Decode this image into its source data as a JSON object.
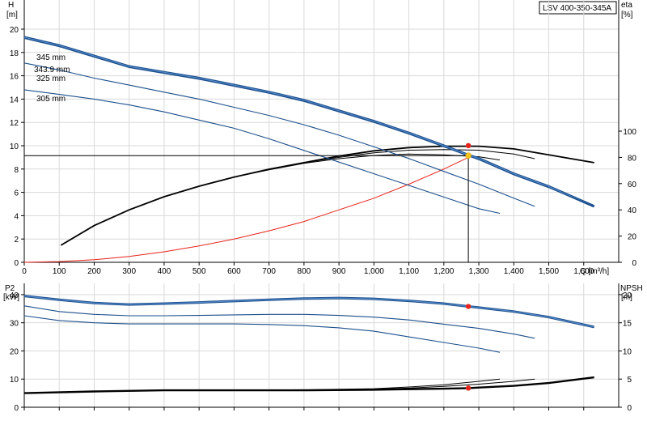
{
  "chart_data": [
    {
      "type": "line",
      "model_label": "LSV 400-350-345A",
      "axes": {
        "x": {
          "label": "Q [m³/h]",
          "ticks": [
            0,
            100,
            200,
            300,
            400,
            500,
            600,
            700,
            800,
            900,
            1000,
            1100,
            1200,
            1300,
            1400,
            1500,
            1600
          ],
          "tick_labels": [
            "0",
            "100",
            "200",
            "300",
            "400",
            "500",
            "600",
            "700",
            "800",
            "900",
            "1,000",
            "1,100",
            "1,200",
            "1,300",
            "1,400",
            "1,500",
            "1,600"
          ],
          "range": [
            0,
            1700
          ]
        },
        "y_left": {
          "label_line1": "H",
          "label_line2": "[m]",
          "ticks": [
            0,
            2,
            4,
            6,
            8,
            10,
            12,
            14,
            16,
            18,
            20
          ],
          "range": [
            0,
            22.5
          ]
        },
        "y_right": {
          "label_line1": "eta",
          "label_line2": "[%]",
          "ticks": [
            0,
            20,
            40,
            60,
            80,
            100
          ],
          "range": [
            0,
            200
          ]
        }
      },
      "grid": true,
      "head_curves": [
        {
          "name": "345 mm",
          "highlight": true,
          "x": [
            0,
            100,
            200,
            300,
            400,
            500,
            600,
            700,
            800,
            900,
            1000,
            1100,
            1200,
            1270,
            1300,
            1400,
            1500,
            1630
          ],
          "y": [
            19.3,
            18.6,
            17.7,
            16.8,
            16.3,
            15.8,
            15.2,
            14.6,
            13.9,
            13.0,
            12.1,
            11.1,
            10.0,
            9.2,
            8.9,
            7.6,
            6.5,
            4.8
          ]
        },
        {
          "name": "343.9 mm",
          "highlight": false,
          "x": [
            0,
            100,
            200,
            300,
            400,
            500,
            600,
            700,
            800,
            900,
            1000,
            1100,
            1200,
            1300,
            1400,
            1500,
            1630
          ],
          "y": [
            19.2,
            18.5,
            17.6,
            16.7,
            16.2,
            15.7,
            15.1,
            14.5,
            13.8,
            12.9,
            12.0,
            11.0,
            9.9,
            8.8,
            7.5,
            6.4,
            4.8
          ]
        },
        {
          "name": "325 mm",
          "highlight": false,
          "x": [
            0,
            100,
            200,
            300,
            400,
            500,
            600,
            700,
            800,
            900,
            1000,
            1100,
            1200,
            1300,
            1400,
            1460
          ],
          "y": [
            17.1,
            16.5,
            15.8,
            15.2,
            14.6,
            14.0,
            13.3,
            12.6,
            11.8,
            10.9,
            9.9,
            8.9,
            7.8,
            6.7,
            5.5,
            4.8
          ]
        },
        {
          "name": "305 mm",
          "highlight": false,
          "x": [
            0,
            100,
            200,
            300,
            400,
            500,
            600,
            700,
            800,
            900,
            1000,
            1100,
            1200,
            1300,
            1360
          ],
          "y": [
            14.8,
            14.4,
            14.0,
            13.5,
            12.9,
            12.2,
            11.5,
            10.6,
            9.6,
            8.6,
            7.6,
            6.6,
            5.6,
            4.6,
            4.2
          ]
        }
      ],
      "eta_curves": [
        {
          "x": [
            105,
            200,
            300,
            400,
            500,
            600,
            700,
            800,
            900,
            1000,
            1100,
            1200,
            1300,
            1400,
            1500,
            1630
          ],
          "y": [
            13,
            28,
            40,
            50,
            58,
            65,
            71,
            76,
            81,
            85,
            87.5,
            88.5,
            88.5,
            86.5,
            82,
            76
          ]
        },
        {
          "x": [
            105,
            200,
            300,
            400,
            500,
            600,
            700,
            800,
            900,
            1000,
            1100,
            1200,
            1300,
            1400,
            1460
          ],
          "y": [
            13,
            28,
            40,
            50,
            58,
            65,
            71,
            76,
            80,
            83.5,
            85.5,
            86,
            85.5,
            82.5,
            79
          ]
        },
        {
          "x": [
            105,
            200,
            300,
            400,
            500,
            600,
            700,
            800,
            900,
            1000,
            1100,
            1200,
            1300,
            1360
          ],
          "y": [
            13,
            28,
            40,
            50,
            58,
            65,
            70.5,
            75.5,
            79,
            81.5,
            82.5,
            82,
            80.5,
            78
          ]
        }
      ],
      "system_curve": {
        "x": [
          0,
          100,
          200,
          300,
          400,
          500,
          600,
          700,
          800,
          900,
          1000,
          1100,
          1200,
          1270
        ],
        "y": [
          0,
          0.06,
          0.22,
          0.5,
          0.9,
          1.4,
          2.0,
          2.7,
          3.5,
          4.5,
          5.5,
          6.7,
          8.0,
          9.0
        ]
      },
      "operating_point": {
        "q": 1270,
        "h": 9.15,
        "eta": 89
      }
    },
    {
      "type": "line",
      "axes": {
        "x": {
          "range": [
            0,
            1700
          ]
        },
        "y_left": {
          "label_line1": "P2",
          "label_line2": "[kW]",
          "ticks": [
            0,
            10,
            20,
            30,
            40
          ],
          "range": [
            0,
            44
          ]
        },
        "y_right": {
          "label_line1": "NPSH",
          "label_line2": "[m]",
          "ticks": [
            0,
            5,
            10,
            15,
            20
          ],
          "range": [
            0,
            22
          ]
        }
      },
      "grid": true,
      "power_curves": [
        {
          "highlight": true,
          "x": [
            0,
            100,
            200,
            300,
            400,
            500,
            600,
            700,
            800,
            900,
            1000,
            1100,
            1200,
            1270,
            1300,
            1400,
            1500,
            1630
          ],
          "y": [
            39.5,
            38.2,
            37.0,
            36.5,
            36.8,
            37.2,
            37.7,
            38.2,
            38.6,
            38.8,
            38.5,
            37.8,
            36.8,
            35.8,
            35.4,
            34.0,
            32.0,
            28.5
          ]
        },
        {
          "highlight": false,
          "x": [
            0,
            100,
            200,
            300,
            400,
            500,
            600,
            700,
            800,
            900,
            1000,
            1100,
            1200,
            1300,
            1400,
            1460
          ],
          "y": [
            36.0,
            34.0,
            33.0,
            32.5,
            32.5,
            32.6,
            32.8,
            33.0,
            33.0,
            32.6,
            32.0,
            31.0,
            29.5,
            28.0,
            26.0,
            24.5
          ]
        },
        {
          "highlight": false,
          "x": [
            0,
            100,
            200,
            300,
            400,
            500,
            600,
            700,
            800,
            900,
            1000,
            1100,
            1200,
            1300,
            1360
          ],
          "y": [
            32.5,
            30.8,
            30.0,
            29.6,
            29.6,
            29.6,
            29.6,
            29.4,
            29.0,
            28.2,
            27.0,
            25.0,
            23.0,
            21.0,
            19.5
          ]
        }
      ],
      "npsh_curves": [
        {
          "highlight": true,
          "x": [
            0,
            200,
            400,
            600,
            800,
            1000,
            1100,
            1200,
            1270,
            1300,
            1400,
            1500,
            1630
          ],
          "y": [
            2.5,
            2.8,
            3.0,
            3.0,
            3.0,
            3.1,
            3.2,
            3.3,
            3.4,
            3.5,
            3.8,
            4.3,
            5.3
          ]
        },
        {
          "highlight": false,
          "x": [
            0,
            200,
            400,
            600,
            800,
            1000,
            1100,
            1200,
            1300,
            1400,
            1460
          ],
          "y": [
            2.5,
            2.8,
            3.0,
            3.0,
            3.0,
            3.2,
            3.4,
            3.7,
            4.1,
            4.6,
            5.0
          ]
        },
        {
          "highlight": false,
          "x": [
            0,
            200,
            400,
            600,
            800,
            1000,
            1100,
            1200,
            1300,
            1360
          ],
          "y": [
            2.5,
            2.8,
            3.0,
            3.0,
            3.1,
            3.3,
            3.6,
            4.0,
            4.6,
            5.0
          ]
        }
      ],
      "operating_point": {
        "q": 1270,
        "p2": 35.8,
        "npsh": 3.4
      }
    }
  ]
}
